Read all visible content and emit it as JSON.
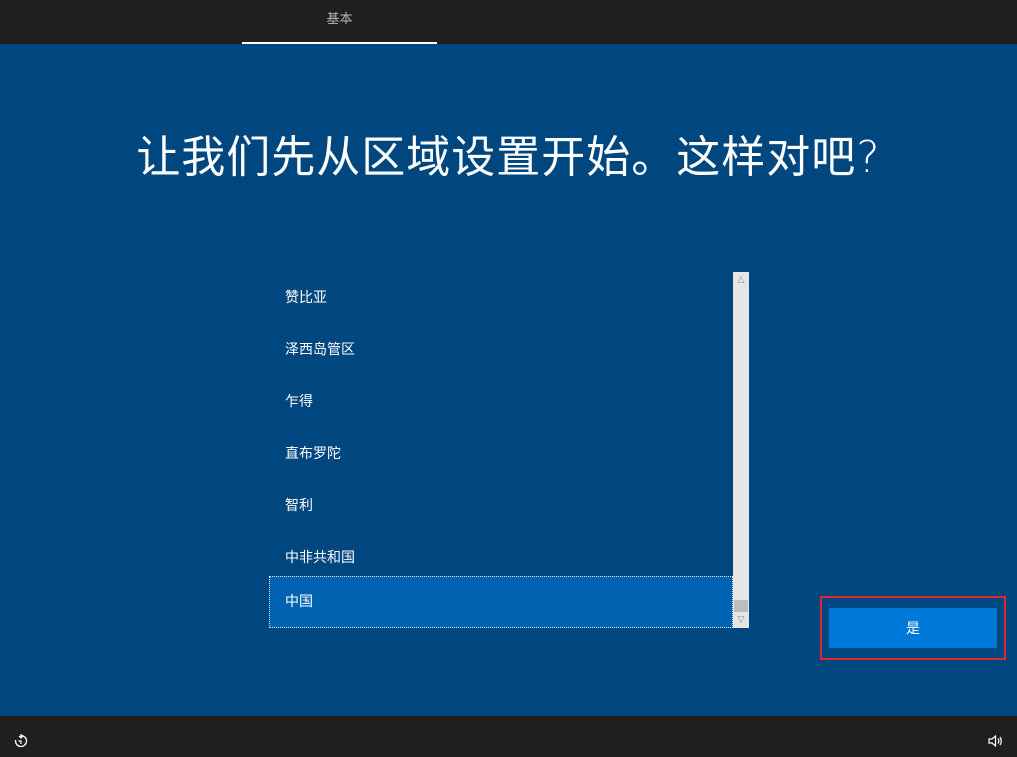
{
  "header": {
    "tab_label": "基本"
  },
  "main": {
    "heading": "让我们先从区域设置开始。这样对吧?",
    "region_list": {
      "items": [
        "赞比亚",
        "泽西岛管区",
        "乍得",
        "直布罗陀",
        "智利",
        "中非共和国",
        "中国"
      ],
      "selected": "中国"
    },
    "confirm_label": "是"
  },
  "footer": {
    "left_icon": "accessibility-icon",
    "right_icon": "volume-icon"
  },
  "colors": {
    "background": "#00467f",
    "selected": "#0063b1",
    "button": "#0078d7",
    "highlight_frame": "#e0262c"
  }
}
